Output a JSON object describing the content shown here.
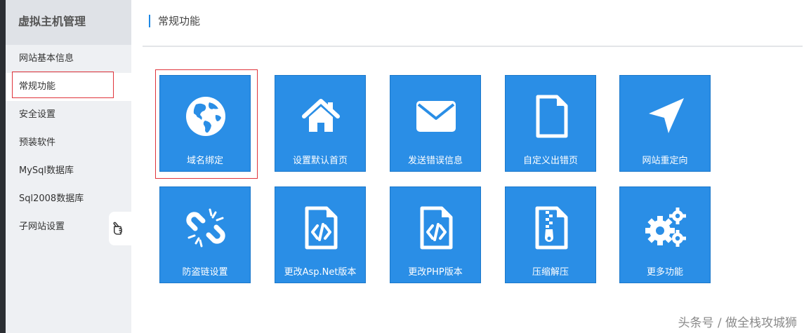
{
  "sidebar": {
    "title": "虚拟主机管理",
    "items": [
      {
        "label": "网站基本信息"
      },
      {
        "label": "常规功能"
      },
      {
        "label": "安全设置"
      },
      {
        "label": "预装软件"
      },
      {
        "label": "MySql数据库"
      },
      {
        "label": "Sql2008数据库"
      },
      {
        "label": "子网站设置"
      }
    ],
    "active_index": 1
  },
  "main": {
    "title": "常规功能",
    "tiles": [
      {
        "label": "域名绑定",
        "icon": "globe-icon"
      },
      {
        "label": "设置默认首页",
        "icon": "home-icon"
      },
      {
        "label": "发送错误信息",
        "icon": "envelope-icon"
      },
      {
        "label": "自定义出错页",
        "icon": "file-icon"
      },
      {
        "label": "网站重定向",
        "icon": "location-arrow-icon"
      },
      {
        "label": "防盗链设置",
        "icon": "broken-link-icon"
      },
      {
        "label": "更改Asp.Net版本",
        "icon": "code-file-icon"
      },
      {
        "label": "更改PHP版本",
        "icon": "code-file-icon"
      },
      {
        "label": "压缩解压",
        "icon": "zip-file-icon"
      },
      {
        "label": "更多功能",
        "icon": "gears-icon"
      }
    ]
  },
  "watermark": "头条号 / 做全栈攻城狮",
  "colors": {
    "tile": "#2a8ee6",
    "highlight": "#e0343b",
    "sidebar": "#eef0f3"
  }
}
